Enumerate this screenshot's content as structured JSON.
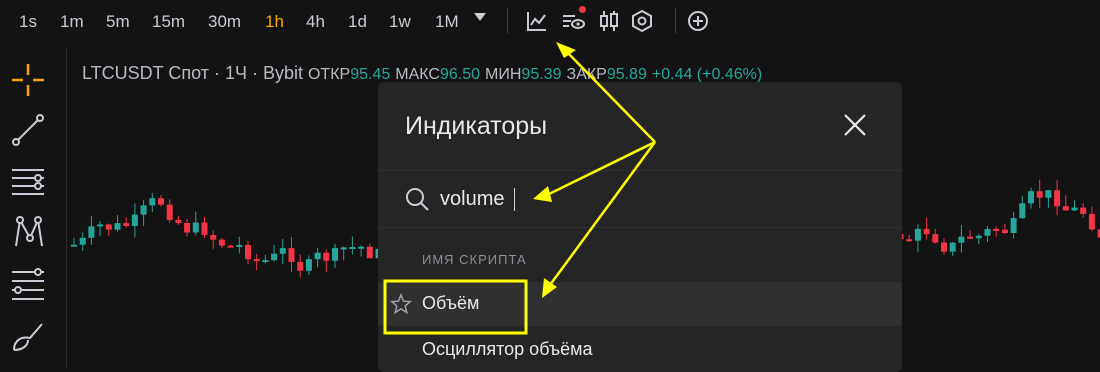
{
  "toolbar": {
    "timeframes": [
      "1s",
      "1m",
      "5m",
      "15m",
      "30m",
      "1h",
      "4h",
      "1d",
      "1w",
      "1M"
    ],
    "active_timeframe": "1h",
    "accent": "#f7a600",
    "icons": [
      "chevron-down-icon",
      "indicators-chart-icon",
      "indicator-templates-icon",
      "candlestick-type-icon",
      "chart-settings-icon",
      "add-icon"
    ]
  },
  "legend": {
    "symbol": "LTCUSDT Спот · 1Ч · Bybit",
    "open_label": "ОТКР",
    "open_value": "95.45",
    "high_label": "МАКС",
    "high_value": "96.50",
    "low_label": "МИН",
    "low_value": "95.39",
    "close_label": "ЗАКР",
    "close_value": "95.89",
    "change": "+0.44 (+0.46%)"
  },
  "colors": {
    "up": "#26a69a",
    "down": "#f23645",
    "annotation": "#ffff00"
  },
  "modal": {
    "title": "Индикаторы",
    "search": {
      "value": "volume",
      "placeholder": ""
    },
    "section_header": "ИМЯ СКРИПТА",
    "results": [
      "Объём",
      "Осциллятор объёма"
    ]
  }
}
